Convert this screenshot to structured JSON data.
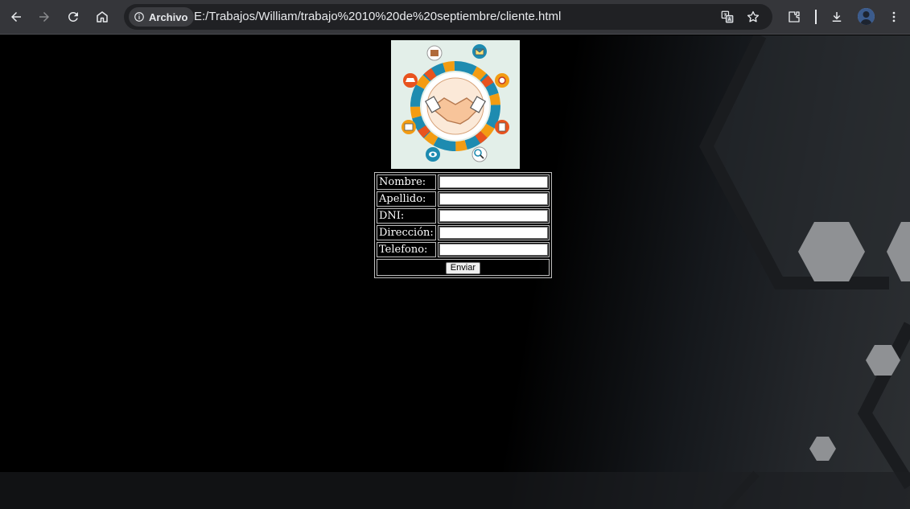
{
  "browser": {
    "chip_label": "Archivo",
    "url": "E:/Trabajos/William/trabajo%2010%20de%20septiembre/cliente.html"
  },
  "form": {
    "fields": [
      {
        "label": "Nombre:",
        "value": ""
      },
      {
        "label": "Apellido:",
        "value": ""
      },
      {
        "label": "DNI:",
        "value": ""
      },
      {
        "label": "Dirección:",
        "value": ""
      },
      {
        "label": "Telefono:",
        "value": ""
      }
    ],
    "submit_label": "Enviar"
  },
  "colors": {
    "toolbar": "#35363a",
    "omnibox": "#202124",
    "page_bg": "#000000",
    "hexagon": "#8f9194"
  }
}
